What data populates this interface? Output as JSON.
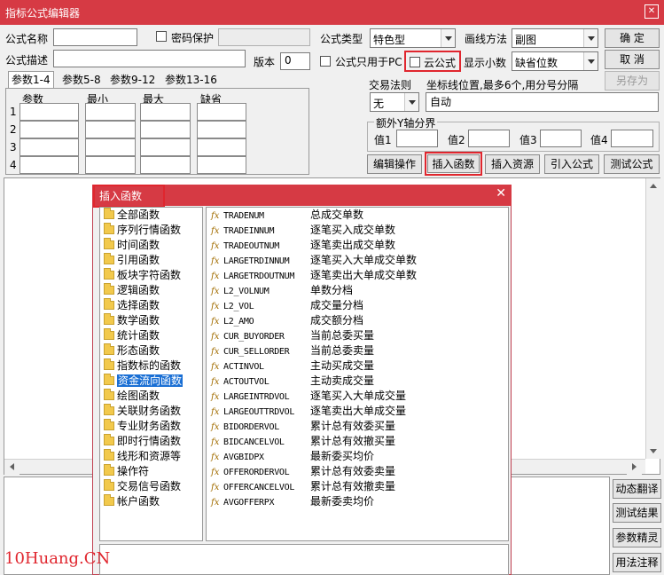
{
  "window": {
    "title": "指标公式编辑器"
  },
  "form": {
    "name_label": "公式名称",
    "name_value": "",
    "password_label": "密码保护",
    "password_value": "",
    "desc_label": "公式描述",
    "desc_value": "",
    "version_label": "版本",
    "version_value": "0",
    "type_label": "公式类型",
    "type_value": "特色型",
    "draw_label": "画线方法",
    "draw_value": "副图",
    "pc_only_label": "公式只用于PC",
    "cloud_label": "云公式",
    "decimals_label": "显示小数",
    "decimals_value": "缺省位数",
    "trade_rule_label": "交易法则",
    "trade_rule_value": "无",
    "axis_label": "坐标线位置,最多6个,用分号分隔",
    "axis_value": "自动",
    "extra_axis_label": "额外Y轴分界",
    "val_labels": [
      "值1",
      "值2",
      "值3",
      "值4"
    ]
  },
  "buttons": {
    "ok": "确  定",
    "cancel": "取  消",
    "save_as": "另存为",
    "edit_ops": "编辑操作",
    "insert_func": "插入函数",
    "insert_res": "插入资源",
    "import": "引入公式",
    "test": "测试公式"
  },
  "tabs": [
    "参数1-4",
    "参数5-8",
    "参数9-12",
    "参数13-16"
  ],
  "params": {
    "headers": [
      "参数",
      "最小",
      "最大",
      "缺省"
    ],
    "rows": [
      "1",
      "2",
      "3",
      "4"
    ]
  },
  "dialog": {
    "title": "插入函数",
    "categories": [
      "全部函数",
      "序列行情函数",
      "时间函数",
      "引用函数",
      "板块字符函数",
      "逻辑函数",
      "选择函数",
      "数学函数",
      "统计函数",
      "形态函数",
      "指数标的函数",
      "资金流向函数",
      "绘图函数",
      "关联财务函数",
      "专业财务函数",
      "即时行情函数",
      "线形和资源等",
      "操作符",
      "交易信号函数",
      "帐户函数"
    ],
    "selected_category": "资金流向函数",
    "functions": [
      {
        "code": "TRADENUM",
        "desc": "总成交单数"
      },
      {
        "code": "TRADEINNUM",
        "desc": "逐笔买入成交单数"
      },
      {
        "code": "TRADEOUTNUM",
        "desc": "逐笔卖出成交单数"
      },
      {
        "code": "LARGETRDINNUM",
        "desc": "逐笔买入大单成交单数"
      },
      {
        "code": "LARGETRDOUTNUM",
        "desc": "逐笔卖出大单成交单数"
      },
      {
        "code": "L2_VOLNUM",
        "desc": "单数分档"
      },
      {
        "code": "L2_VOL",
        "desc": "成交量分档"
      },
      {
        "code": "L2_AMO",
        "desc": "成交额分档"
      },
      {
        "code": "CUR_BUYORDER",
        "desc": "当前总委买量"
      },
      {
        "code": "CUR_SELLORDER",
        "desc": "当前总委卖量"
      },
      {
        "code": "ACTINVOL",
        "desc": "主动买成交量"
      },
      {
        "code": "ACTOUTVOL",
        "desc": "主动卖成交量"
      },
      {
        "code": "LARGEINTRDVOL",
        "desc": "逐笔买入大单成交量"
      },
      {
        "code": "LARGEOUTTRDVOL",
        "desc": "逐笔卖出大单成交量"
      },
      {
        "code": "BIDORDERVOL",
        "desc": "累计总有效委买量"
      },
      {
        "code": "BIDCANCELVOL",
        "desc": "累计总有效撤买量"
      },
      {
        "code": "AVGBIDPX",
        "desc": "最新委买均价"
      },
      {
        "code": "OFFERORDERVOL",
        "desc": "累计总有效委卖量"
      },
      {
        "code": "OFFERCANCELVOL",
        "desc": "累计总有效撤卖量"
      },
      {
        "code": "AVGOFFERPX",
        "desc": "最新委卖均价"
      }
    ],
    "fx": "fx"
  },
  "side_buttons": [
    "动态翻译",
    "测试结果",
    "参数精灵",
    "用法注释"
  ],
  "watermark": "10Huang.CN",
  "colors": {
    "titlebar": "#d63a44",
    "highlight_box": "#e0262e",
    "selection": "#1a6fd4",
    "watermark": "#e0262e"
  }
}
